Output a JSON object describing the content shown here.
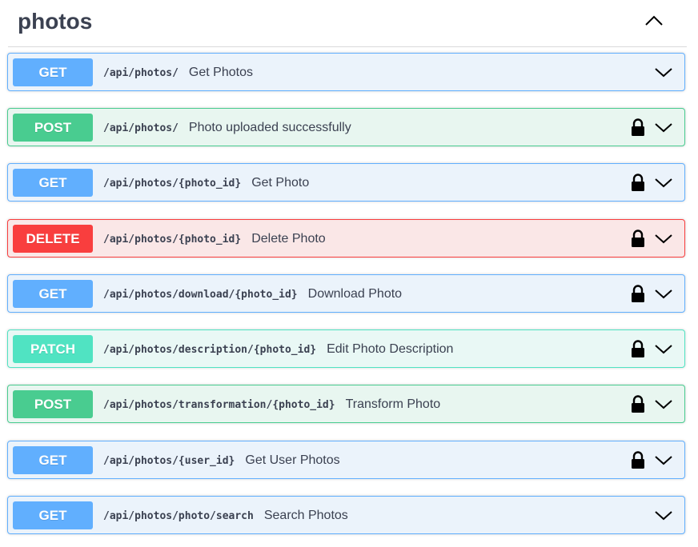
{
  "tag": {
    "title": "photos",
    "toggle_icon": "chevron-up-icon"
  },
  "colors": {
    "get": "#61affe",
    "post": "#49cc90",
    "delete": "#f93e3e",
    "patch": "#50e3c2",
    "text": "#3b4151"
  },
  "operations": [
    {
      "method": "GET",
      "path": "/api/photos/",
      "summary": "Get Photos",
      "locked": false
    },
    {
      "method": "POST",
      "path": "/api/photos/",
      "summary": "Photo uploaded successfully",
      "locked": true
    },
    {
      "method": "GET",
      "path": "/api/photos/{photo_id}",
      "summary": "Get Photo",
      "locked": true
    },
    {
      "method": "DELETE",
      "path": "/api/photos/{photo_id}",
      "summary": "Delete Photo",
      "locked": true
    },
    {
      "method": "GET",
      "path": "/api/photos/download/{photo_id}",
      "summary": "Download Photo",
      "locked": true
    },
    {
      "method": "PATCH",
      "path": "/api/photos/description/{photo_id}",
      "summary": "Edit Photo Description",
      "locked": true
    },
    {
      "method": "POST",
      "path": "/api/photos/transformation/{photo_id}",
      "summary": "Transform Photo",
      "locked": true
    },
    {
      "method": "GET",
      "path": "/api/photos/{user_id}",
      "summary": "Get User Photos",
      "locked": true
    },
    {
      "method": "GET",
      "path": "/api/photos/photo/search",
      "summary": "Search Photos",
      "locked": false
    }
  ]
}
